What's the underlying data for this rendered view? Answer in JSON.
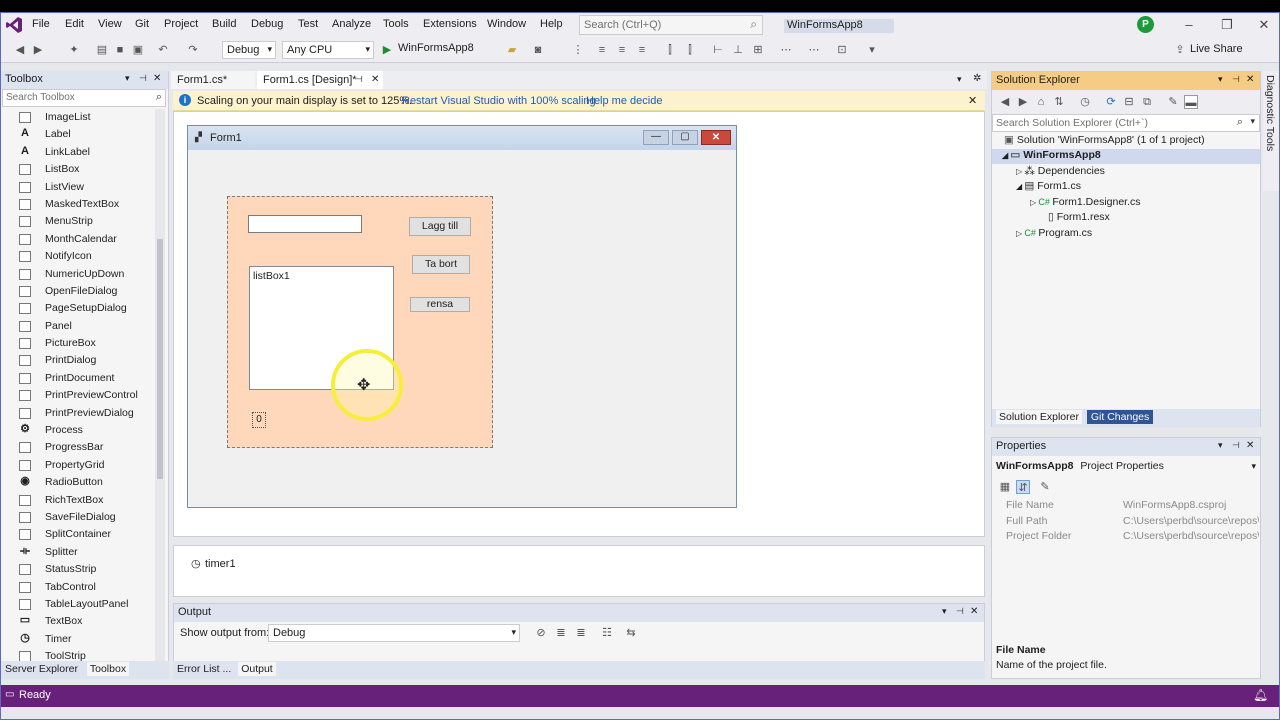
{
  "menu": [
    "File",
    "Edit",
    "View",
    "Git",
    "Project",
    "Build",
    "Debug",
    "Test",
    "Analyze",
    "Tools",
    "Extensions",
    "Window",
    "Help"
  ],
  "search": {
    "placeholder": "Search (Ctrl+Q)"
  },
  "window_title": "WinFormsApp8",
  "user_initial": "P",
  "toolbar": {
    "config": "Debug",
    "platform": "Any CPU",
    "run_label": "WinFormsApp8",
    "live_share": "Live Share"
  },
  "toolbox": {
    "title": "Toolbox",
    "search_placeholder": "Search Toolbox",
    "items": [
      "ImageList",
      "Label",
      "LinkLabel",
      "ListBox",
      "ListView",
      "MaskedTextBox",
      "MenuStrip",
      "MonthCalendar",
      "NotifyIcon",
      "NumericUpDown",
      "OpenFileDialog",
      "PageSetupDialog",
      "Panel",
      "PictureBox",
      "PrintDialog",
      "PrintDocument",
      "PrintPreviewControl",
      "PrintPreviewDialog",
      "Process",
      "ProgressBar",
      "PropertyGrid",
      "RadioButton",
      "RichTextBox",
      "SaveFileDialog",
      "SplitContainer",
      "Splitter",
      "StatusStrip",
      "TabControl",
      "TableLayoutPanel",
      "TextBox",
      "Timer",
      "ToolStrip"
    ],
    "bottom_tabs": [
      "Server Explorer",
      "Toolbox"
    ]
  },
  "doc_tabs": [
    "Form1.cs*",
    "Form1.cs [Design]*"
  ],
  "infobar": {
    "message": "Scaling on your main display is set to 125%.",
    "link1": "Restart Visual Studio with 100% scaling",
    "link2": "Help me decide"
  },
  "form": {
    "title": "Form1",
    "btn_add": "Lagg till",
    "btn_remove": "Ta bort",
    "btn_clear": "rensa",
    "listbox": "listBox1",
    "label_value": "0"
  },
  "tray": {
    "component": "timer1"
  },
  "output": {
    "title": "Output",
    "show_from_label": "Show output from:",
    "source": "Debug",
    "bottom_tabs": [
      "Error List ...",
      "Output"
    ]
  },
  "solution_explorer": {
    "title": "Solution Explorer",
    "search_placeholder": "Search Solution Explorer (Ctrl+`)",
    "solution": "Solution 'WinFormsApp8' (1 of 1 project)",
    "project": "WinFormsApp8",
    "dependencies": "Dependencies",
    "form_cs": "Form1.cs",
    "designer_cs": "Form1.Designer.cs",
    "resx": "Form1.resx",
    "program": "Program.cs",
    "bottom_tabs": [
      "Solution Explorer",
      "Git Changes"
    ]
  },
  "properties": {
    "title": "Properties",
    "object": "WinFormsApp8",
    "object_type": "Project Properties",
    "rows": [
      {
        "name": "File Name",
        "value": "WinFormsApp8.csproj"
      },
      {
        "name": "Full Path",
        "value": "C:\\Users\\perbd\\source\\repos\\W"
      },
      {
        "name": "Project Folder",
        "value": "C:\\Users\\perbd\\source\\repos\\W"
      }
    ],
    "desc_title": "File Name",
    "desc_text": "Name of the project file."
  },
  "diag_tools": "Diagnostic Tools",
  "status": {
    "text": "Ready"
  },
  "colors": {
    "accent": "#68217a",
    "panel_bg": "#ffd8bb",
    "infobar": "#fcf2cd"
  }
}
